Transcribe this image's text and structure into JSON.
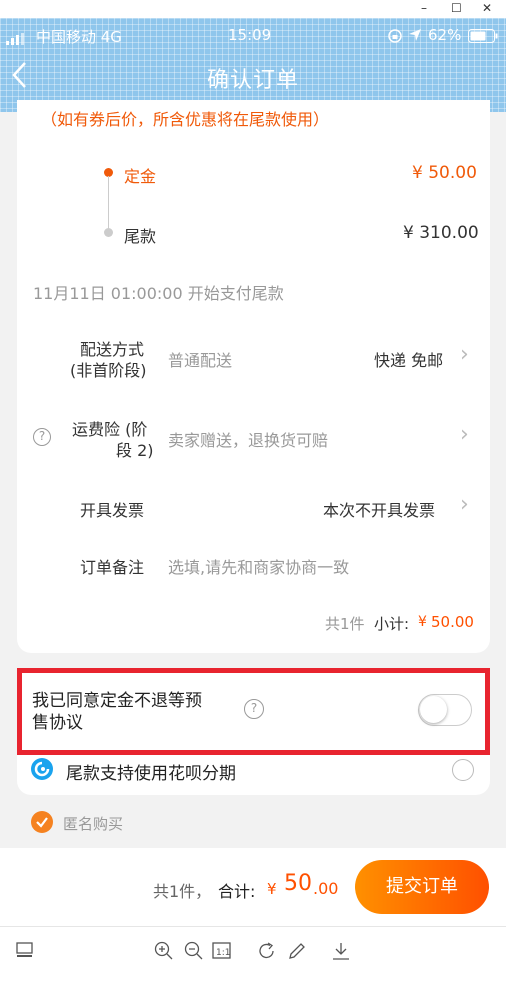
{
  "window": {
    "minimize": "–",
    "maximize": "☐",
    "close": "✕"
  },
  "status": {
    "carrier": "中国移动 4G",
    "time": "15:09",
    "battery": "62%"
  },
  "header": {
    "back": "‹",
    "title": "确认订单"
  },
  "deposit": {
    "note": "（如有券后价，所含优惠将在尾款使用）",
    "deposit_label": "定金",
    "deposit_value": "¥ 50.00",
    "balance_label": "尾款",
    "balance_value": "¥ 310.00",
    "balance_start": "11月11日 01:00:00 开始支付尾款"
  },
  "delivery": {
    "label_line1": "配送方式",
    "label_line2": "(非首阶段)",
    "method": "普通配送",
    "value": "快递 免邮"
  },
  "insurance": {
    "label_line1": "运费险 (阶",
    "label_line2": "段 2)",
    "value": "卖家赠送，退换货可赔"
  },
  "invoice": {
    "label": "开具发票",
    "value": "本次不开具发票"
  },
  "remark": {
    "label": "订单备注",
    "placeholder": "选填,请先和商家协商一致"
  },
  "subtotal": {
    "count": "共1件",
    "label": "小计:",
    "currency": "¥",
    "value": "50.00"
  },
  "agreement": {
    "line1": "我已同意定金不退等预",
    "line2": "售协议",
    "toggle_on": false
  },
  "huabei": {
    "label": "尾款支持使用花呗分期"
  },
  "anonymous": {
    "label": "匿名购买",
    "checked": true
  },
  "footer": {
    "count": "共1件，",
    "total_label": "合计:",
    "currency": "¥",
    "total_int": "50",
    "total_dec": ".00",
    "submit": "提交订单"
  },
  "colors": {
    "accent": "#ff5000",
    "red_text": "#f05a0a",
    "highlight_box": "#e8242f"
  }
}
